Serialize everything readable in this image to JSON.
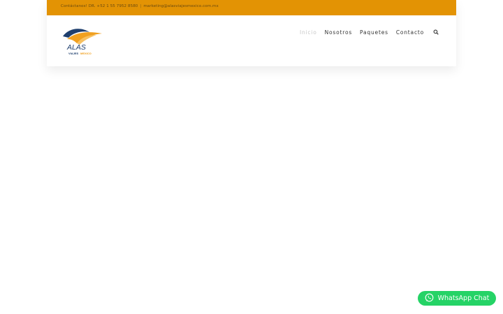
{
  "topbar": {
    "contact_text": "Contáctanos! DR. +52 1 55 7952 8580",
    "separator": "|",
    "email": "marketing@alasviajesmexico.com.mx"
  },
  "logo": {
    "name": "ALAS",
    "tagline_viajes": "VIAJES",
    "tagline_mexico": "MEXICO"
  },
  "nav": {
    "items": [
      "Inicio",
      "Nosotros",
      "Paquetes",
      "Contacto"
    ],
    "active_index": 0,
    "search_icon": "search-icon"
  },
  "whatsapp": {
    "label": "WhatsApp Chat",
    "icon": "whatsapp-icon",
    "color": "#25d366"
  },
  "colors": {
    "topbar": "#e39304",
    "logo_blue": "#1f3f6e",
    "logo_orange": "#f0a020"
  }
}
